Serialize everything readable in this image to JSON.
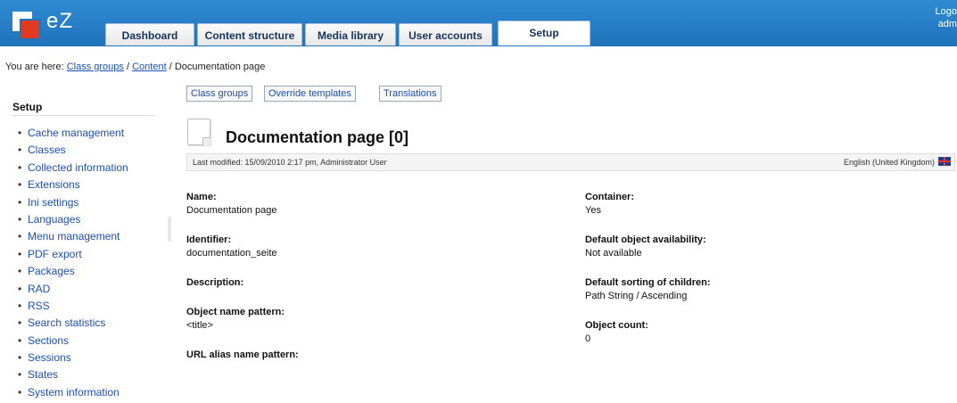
{
  "header": {
    "logo_text": "eZ",
    "tabs": [
      {
        "label": "Dashboard"
      },
      {
        "label": "Content structure"
      },
      {
        "label": "Media library"
      },
      {
        "label": "User accounts"
      },
      {
        "label": "Setup",
        "active": true
      }
    ],
    "logout_line1": "Logo",
    "logout_line2": "adm"
  },
  "breadcrumb": {
    "prefix": "You are here:",
    "items": [
      "Class groups",
      "Content"
    ],
    "separator": "/",
    "current": "Documentation page"
  },
  "sidebar": {
    "title": "Setup",
    "items": [
      {
        "label": "Cache management"
      },
      {
        "label": "Classes"
      },
      {
        "label": "Collected information"
      },
      {
        "label": "Extensions"
      },
      {
        "label": "Ini settings"
      },
      {
        "label": "Languages"
      },
      {
        "label": "Menu management"
      },
      {
        "label": "PDF export"
      },
      {
        "label": "Packages"
      },
      {
        "label": "RAD"
      },
      {
        "label": "RSS"
      },
      {
        "label": "Search statistics"
      },
      {
        "label": "Sections"
      },
      {
        "label": "Sessions"
      },
      {
        "label": "States"
      },
      {
        "label": "System information"
      }
    ]
  },
  "subnav": {
    "buttons": [
      {
        "label": "Class groups"
      },
      {
        "label": "Override templates"
      },
      {
        "label": "Translations"
      }
    ]
  },
  "main": {
    "title": "Documentation page [0]",
    "last_modified": "Last modified: 15/09/2010 2:17 pm, Administrator User",
    "language": "English (United Kingdom)",
    "left_props": [
      {
        "label": "Name:",
        "value": "Documentation page"
      },
      {
        "label": "Identifier:",
        "value": "documentation_seite"
      },
      {
        "label": "Description:",
        "value": ""
      },
      {
        "label": "Object name pattern:",
        "value": "<title>"
      },
      {
        "label": "URL alias name pattern:",
        "value": ""
      }
    ],
    "right_props": [
      {
        "label": "Container:",
        "value": "Yes"
      },
      {
        "label": "Default object availability:",
        "value": "Not available"
      },
      {
        "label": "Default sorting of children:",
        "value": "Path String / Ascending"
      },
      {
        "label": "Object count:",
        "value": "0"
      }
    ]
  },
  "colors": {
    "topbar": "#2679c4",
    "link": "#1a4fb5",
    "logo_red": "#e23a1f"
  }
}
